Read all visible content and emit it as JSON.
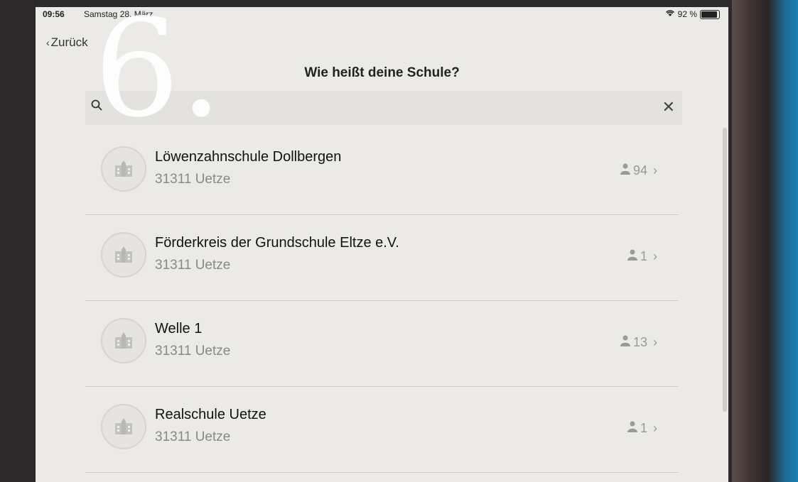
{
  "statusbar": {
    "time": "09:56",
    "date": "Samstag 28. März",
    "battery": "92 %"
  },
  "nav": {
    "back_label": "Zurück",
    "title": "Wie heißt deine Schule?"
  },
  "overlay": {
    "text": "6."
  },
  "search": {
    "value": "",
    "placeholder": ""
  },
  "schools": [
    {
      "name": "Löwenzahnschule Dollbergen",
      "city": "31311 Uetze",
      "members": "94"
    },
    {
      "name": "Förderkreis der Grundschule Eltze e.V.",
      "city": "31311 Uetze",
      "members": "1"
    },
    {
      "name": "Welle 1",
      "city": "31311 Uetze",
      "members": "13"
    },
    {
      "name": "Realschule Uetze",
      "city": "31311 Uetze",
      "members": "1"
    }
  ]
}
